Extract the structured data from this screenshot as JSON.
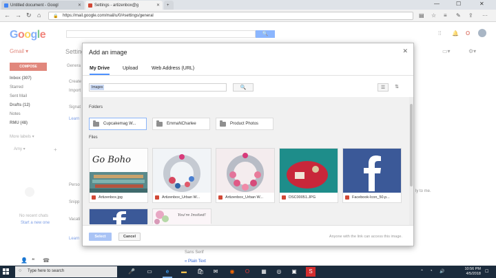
{
  "browser": {
    "tabs": [
      {
        "label": "Untitled document - Googl",
        "favicon_color": "#4285f4"
      },
      {
        "label": "Settings - artizenbox@g",
        "favicon_color": "#d14836"
      }
    ],
    "url": "https://mail.google.com/mail/u/0/#settings/general"
  },
  "gmail": {
    "logo_letters": [
      "G",
      "o",
      "o",
      "g",
      "l",
      "e"
    ],
    "search_button": "🔍",
    "app_title": "Gmail ▾",
    "settings_title": "Settings",
    "compose_label": "COMPOSE",
    "nav": [
      {
        "label": "Inbox (307)",
        "bold": true
      },
      {
        "label": "Starred",
        "bold": false
      },
      {
        "label": "Sent Mail",
        "bold": false
      },
      {
        "label": "Drafts (12)",
        "bold": true
      },
      {
        "label": "Notes",
        "bold": false
      },
      {
        "label": "RMU (48)",
        "bold": true
      }
    ],
    "more_labels": "More labels ▾",
    "user_name": "Amy ▾",
    "no_recent_chats": "No recent chats",
    "start_new_one": "Start a new one",
    "side_labels": {
      "general": "Genera",
      "create": "Create",
      "import": "Import",
      "signature": "Signat",
      "learn": "Learn",
      "personal": "Perso",
      "snippets": "Snipp",
      "vacation": "Vacati",
      "learn2": "Learn"
    },
    "reply_hint": "ly to me.",
    "font_label": "Sans Serif",
    "plain_text": "« Plain Text"
  },
  "dialog": {
    "title": "Add an image",
    "tabs": [
      "My Drive",
      "Upload",
      "Web Address (URL)"
    ],
    "active_tab": 0,
    "search_scope": "Images",
    "search_placeholder": "",
    "folders_heading": "Folders",
    "folders": [
      {
        "name": "Cupcakemag W...",
        "selected": true
      },
      {
        "name": "EmmaNCharlee",
        "selected": false
      },
      {
        "name": "Product Photos",
        "selected": false
      }
    ],
    "files_heading": "Files",
    "files": [
      {
        "name": "Artizenbox.jpg"
      },
      {
        "name": "Artizenbox_Urban W..."
      },
      {
        "name": "Artizenbox_Urban W..."
      },
      {
        "name": "DSC00051.JPG"
      },
      {
        "name": "Facebook-Icon_50.p..."
      }
    ],
    "partial_file_text": "You're Invited!",
    "select_label": "Select",
    "cancel_label": "Cancel",
    "footer_note": "Anyone with the link can access this image."
  },
  "taskbar": {
    "search_text": "Type here to search",
    "time": "10:56 PM",
    "date": "4/5/2018"
  }
}
